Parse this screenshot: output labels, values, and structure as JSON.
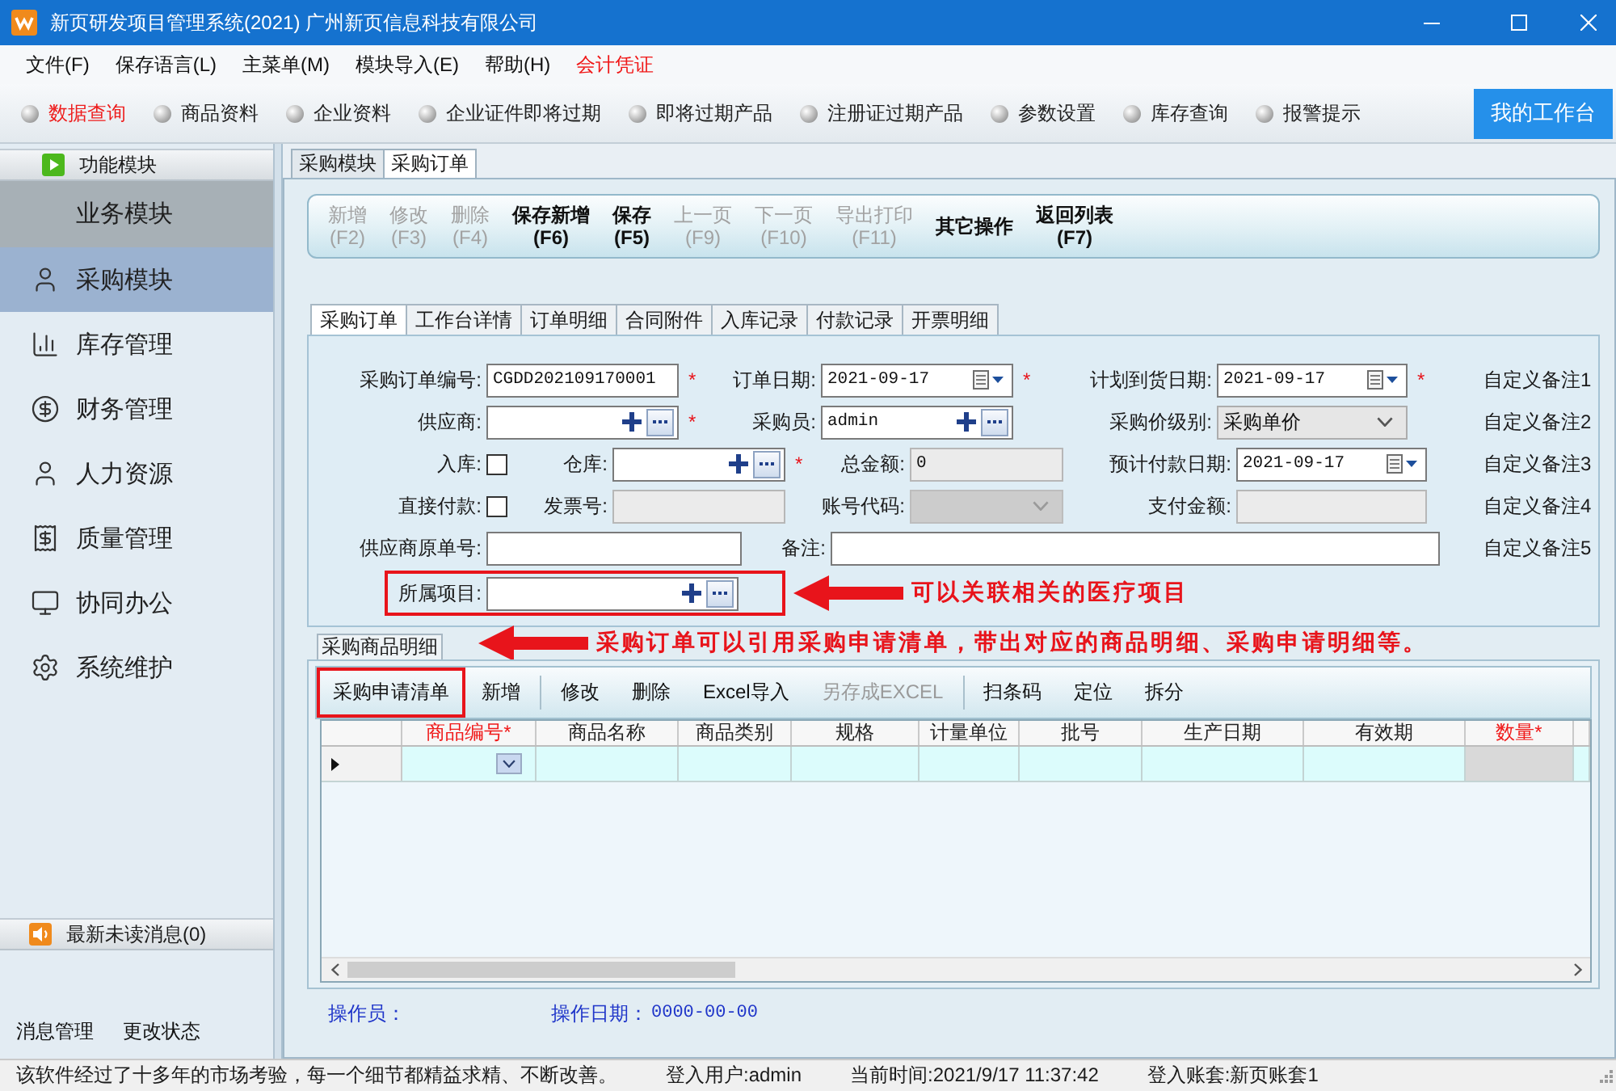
{
  "window": {
    "title": "新页研发项目管理系统(2021) 广州新页信息科技有限公司"
  },
  "menu": [
    {
      "label": "文件(F)",
      "highlighted": false
    },
    {
      "label": "保存语言(L)",
      "highlighted": false
    },
    {
      "label": "主菜单(M)",
      "highlighted": false
    },
    {
      "label": "模块导入(E)",
      "highlighted": false
    },
    {
      "label": "帮助(H)",
      "highlighted": false
    },
    {
      "label": "会计凭证",
      "highlighted": true
    }
  ],
  "quick_bar": {
    "items": [
      {
        "label": "数据查询",
        "selected": true
      },
      {
        "label": "商品资料",
        "selected": false
      },
      {
        "label": "企业资料",
        "selected": false
      },
      {
        "label": "企业证件即将过期",
        "selected": false
      },
      {
        "label": "即将过期产品",
        "selected": false
      },
      {
        "label": "注册证过期产品",
        "selected": false
      },
      {
        "label": "参数设置",
        "selected": false
      },
      {
        "label": "库存查询",
        "selected": false
      },
      {
        "label": "报警提示",
        "selected": false
      }
    ],
    "workspace_button": "我的工作台"
  },
  "sidebar": {
    "header": "功能模块",
    "section": "业务模块",
    "items": [
      {
        "label": "采购模块",
        "selected": true
      },
      {
        "label": "库存管理",
        "selected": false
      },
      {
        "label": "财务管理",
        "selected": false
      },
      {
        "label": "人力资源",
        "selected": false
      },
      {
        "label": "质量管理",
        "selected": false
      },
      {
        "label": "协同办公",
        "selected": false
      },
      {
        "label": "系统维护",
        "selected": false
      }
    ],
    "messages": "最新未读消息(0)",
    "links": [
      "消息管理",
      "更改状态"
    ]
  },
  "document_tabs": [
    {
      "label": "采购模块",
      "selected": false
    },
    {
      "label": "采购订单",
      "selected": true
    }
  ],
  "toolbar": [
    {
      "label": "新增",
      "shortcut": "(F2)",
      "disabled": true
    },
    {
      "label": "修改",
      "shortcut": "(F3)",
      "disabled": true
    },
    {
      "label": "删除",
      "shortcut": "(F4)",
      "disabled": true
    },
    {
      "label": "保存新增",
      "shortcut": "(F6)",
      "disabled": false
    },
    {
      "label": "保存",
      "shortcut": "(F5)",
      "disabled": false
    },
    {
      "label": "上一页",
      "shortcut": "(F9)",
      "disabled": true
    },
    {
      "label": "下一页",
      "shortcut": "(F10)",
      "disabled": true
    },
    {
      "label": "导出打印",
      "shortcut": "(F11)",
      "disabled": true
    },
    {
      "label": "其它操作",
      "disabled": false
    },
    {
      "label": "返回列表",
      "shortcut": "(F7)",
      "disabled": false
    }
  ],
  "form_tabs": [
    {
      "label": "采购订单",
      "selected": true
    },
    {
      "label": "工作台详情",
      "selected": false
    },
    {
      "label": "订单明细",
      "selected": false
    },
    {
      "label": "合同附件",
      "selected": false
    },
    {
      "label": "入库记录",
      "selected": false
    },
    {
      "label": "付款记录",
      "selected": false
    },
    {
      "label": "开票明细",
      "selected": false
    }
  ],
  "form": {
    "required_mark": "*",
    "rows": [
      {
        "fields": [
          {
            "label": "采购订单编号:",
            "kind": "text",
            "value": "CGDD202109170001",
            "required": true,
            "disabled": false
          },
          {
            "label": "订单日期:",
            "kind": "date",
            "value": "2021-09-17",
            "required": true,
            "disabled": false
          },
          {
            "label": "计划到货日期:",
            "kind": "date",
            "value": "2021-09-17",
            "required": true,
            "disabled": false
          }
        ],
        "note": "自定义备注1"
      },
      {
        "fields": [
          {
            "label": "供应商:",
            "kind": "lookup",
            "required": true,
            "disabled": false
          },
          {
            "label": "采购员:",
            "kind": "lookup",
            "value": "admin",
            "required": false,
            "disabled": false
          },
          {
            "label": "采购价级别:",
            "kind": "select",
            "value": "采购单价",
            "required": false,
            "disabled": false
          }
        ],
        "note": "自定义备注2"
      },
      {
        "fields": [
          {
            "label": "入库:",
            "kind": "checkbox",
            "checked": false,
            "required": false,
            "disabled": false
          },
          {
            "label": "仓库:",
            "kind": "lookup",
            "required": true,
            "disabled": false
          },
          {
            "label": "总金额:",
            "kind": "text",
            "value": "0",
            "required": false,
            "disabled": true
          },
          {
            "label": "预计付款日期:",
            "kind": "date",
            "value": "2021-09-17",
            "required": false,
            "disabled": false
          }
        ],
        "note": "自定义备注3"
      },
      {
        "fields": [
          {
            "label": "直接付款:",
            "kind": "checkbox",
            "checked": false,
            "required": false,
            "disabled": false
          },
          {
            "label": "发票号:",
            "kind": "text",
            "required": false,
            "disabled": true
          },
          {
            "label": "账号代码:",
            "kind": "select",
            "required": false,
            "disabled": true
          },
          {
            "label": "支付金额:",
            "kind": "text",
            "required": false,
            "disabled": true
          }
        ],
        "note": "自定义备注4"
      },
      {
        "fields": [
          {
            "label": "供应商原单号:",
            "kind": "text",
            "required": false,
            "disabled": false
          },
          {
            "label": "备注:",
            "kind": "text",
            "required": false,
            "disabled": false
          }
        ],
        "note": "自定义备注5"
      }
    ],
    "project": {
      "highlighted": true,
      "fields": [
        {
          "label": "所属项目:",
          "kind": "lookup",
          "required": false,
          "disabled": false
        }
      ],
      "annotation": "可以关联相关的医疗项目"
    }
  },
  "detail": {
    "tab": "采购商品明细",
    "annotation": "采购订单可以引用采购申请清单，带出对应的商品明细、采购申请明细等。",
    "toolbar": [
      {
        "label": "采购申请清单",
        "disabled": false,
        "highlighted": true,
        "separator_after": false
      },
      {
        "label": "新增",
        "disabled": false,
        "highlighted": false,
        "separator_after": true
      },
      {
        "label": "修改",
        "disabled": false,
        "highlighted": false,
        "separator_after": false
      },
      {
        "label": "删除",
        "disabled": false,
        "highlighted": false,
        "separator_after": false
      },
      {
        "label": "Excel导入",
        "disabled": false,
        "highlighted": false,
        "separator_after": false
      },
      {
        "label": "另存成EXCEL",
        "disabled": true,
        "highlighted": false,
        "separator_after": true
      },
      {
        "label": "扫条码",
        "disabled": false,
        "highlighted": false,
        "separator_after": false
      },
      {
        "label": "定位",
        "disabled": false,
        "highlighted": false,
        "separator_after": false
      },
      {
        "label": "拆分",
        "disabled": false,
        "highlighted": false,
        "separator_after": false
      }
    ],
    "columns": [
      {
        "label": "商品编号",
        "kind": "dropdown",
        "required": true
      },
      {
        "label": "商品名称",
        "kind": "text",
        "required": false
      },
      {
        "label": "商品类别",
        "kind": "text",
        "required": false
      },
      {
        "label": "规格",
        "kind": "text",
        "required": false
      },
      {
        "label": "计量单位",
        "kind": "text",
        "required": false
      },
      {
        "label": "批号",
        "kind": "text",
        "required": false
      },
      {
        "label": "生产日期",
        "kind": "text",
        "required": false
      },
      {
        "label": "有效期",
        "kind": "text",
        "required": false
      },
      {
        "label": "数量",
        "kind": "locked",
        "required": true
      },
      {
        "kind": "text"
      }
    ],
    "rows": [
      {
        "selected": true
      }
    ]
  },
  "footer": {
    "operator_label": "操作员：",
    "date_label": "操作日期：",
    "date_value": "0000-00-00"
  },
  "status_bar": {
    "message": "该软件经过了十多年的市场考验，每一个细节都精益求精、不断改善。",
    "user": "登入用户:admin",
    "time": "当前时间:2021/9/17 11:37:42",
    "account": "登入账套:新页账套1"
  }
}
